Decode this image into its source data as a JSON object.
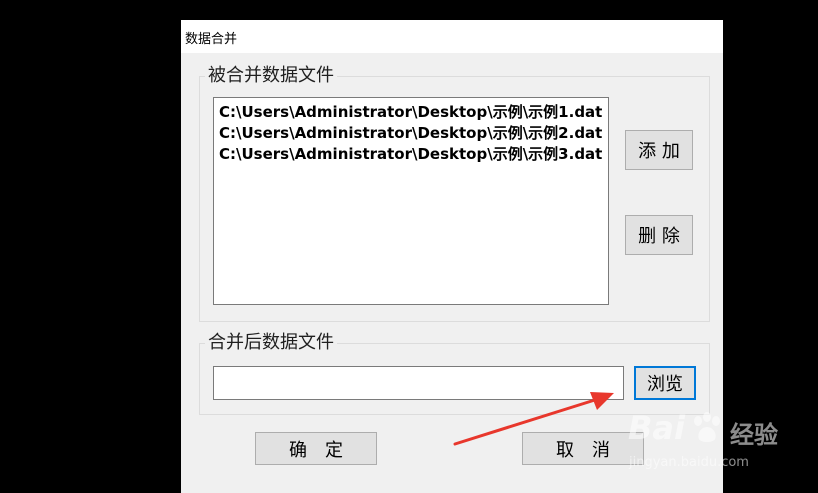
{
  "window": {
    "title": "数据合并"
  },
  "source_group": {
    "caption": "被合并数据文件",
    "files": [
      "C:\\Users\\Administrator\\Desktop\\示例\\示例1.dat",
      "C:\\Users\\Administrator\\Desktop\\示例\\示例2.dat",
      "C:\\Users\\Administrator\\Desktop\\示例\\示例3.dat"
    ],
    "add_label": "添 加",
    "delete_label": "删 除"
  },
  "target_group": {
    "caption": "合并后数据文件",
    "path_value": "",
    "browse_label": "浏览"
  },
  "footer": {
    "ok_label": "确　定",
    "cancel_label": "取　消"
  },
  "watermark": {
    "brand": "Bai",
    "brand_cn": "经验",
    "url": "jingyan.baidu.com"
  },
  "colors": {
    "annotation_arrow": "#e8372c",
    "focus_border": "#0078d7",
    "dialog_bg": "#f0f0f0"
  }
}
